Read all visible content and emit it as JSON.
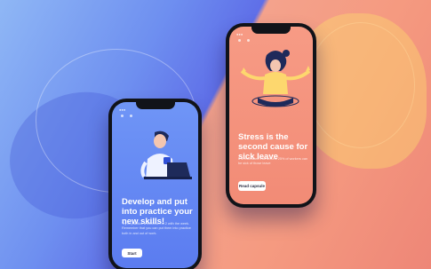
{
  "scene": {
    "colors": {
      "left_bg": "#6e8ff0",
      "right_bg": "#f59a80",
      "accent_yellow": "#fdd76e",
      "phone_frame": "#111319"
    }
  },
  "phone_left": {
    "headline": "Develop and put into practice your new skills!",
    "body": "Try to practice a minimum of 2 with the week. Remember that you can put them into practice both in and out of work.",
    "cta_label": "Start",
    "illustration": "person-with-laptop"
  },
  "phone_right": {
    "headline": "Stress is the second cause for sick leave",
    "body": "It is estimated that around 25% of workers can be sick of those leave",
    "cta_label": "Read capsule",
    "illustration": "person-meditating"
  }
}
